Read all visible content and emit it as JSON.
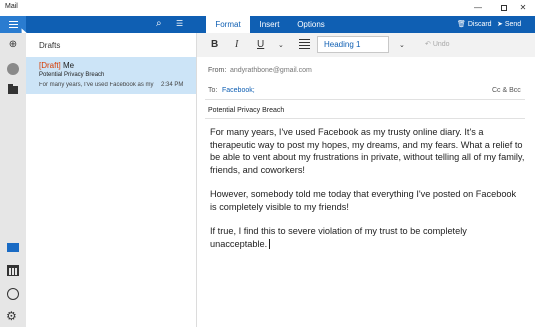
{
  "window": {
    "title": "Mail",
    "minimize": "—",
    "close": "✕"
  },
  "nav": {
    "menu_icon": "hamburger-icon",
    "search_icon": "search-icon",
    "select_icon": "select-mode-icon"
  },
  "ribbon": {
    "tabs": [
      {
        "label": "Format"
      },
      {
        "label": "Insert"
      },
      {
        "label": "Options"
      }
    ],
    "discard_label": "Discard",
    "send_label": "Send"
  },
  "rail": {
    "icons": [
      "new-mail-icon",
      "account-avatar",
      "folders-icon",
      "mail-icon",
      "calendar-icon",
      "feedback-icon",
      "settings-icon"
    ]
  },
  "list": {
    "folder": "Drafts",
    "message": {
      "draft_tag": "[Draft]",
      "sender": "Me",
      "subject": "Potential Privacy Breach",
      "preview": "For many years, I've used Facebook as my",
      "time": "2:34 PM"
    }
  },
  "format": {
    "bold": "B",
    "italic": "I",
    "underline": "U",
    "heading": "Heading 1",
    "undo": "Undo"
  },
  "compose": {
    "from_label": "From:",
    "from": "andyrathbone@gmail.com",
    "to_label": "To:",
    "to": "Facebook;",
    "cc_bcc": "Cc & Bcc",
    "subject": "Potential Privacy Breach",
    "body": [
      "For many years, I've used Facebook as my trusty online diary. It's a therapeutic way to post my hopes, my dreams, and my fears. What a relief to be able to vent about my frustrations in private, without telling all of my family, friends, and coworkers!",
      "However, somebody told me today that everything I've posted on Facebook is completely visible to my friends!",
      "If true, I find this to severe violation of my trust to be completely unacceptable."
    ]
  },
  "colors": {
    "accent": "#0f5fb3",
    "selected_row": "#cce4f7",
    "draft_tag": "#d83b01"
  }
}
